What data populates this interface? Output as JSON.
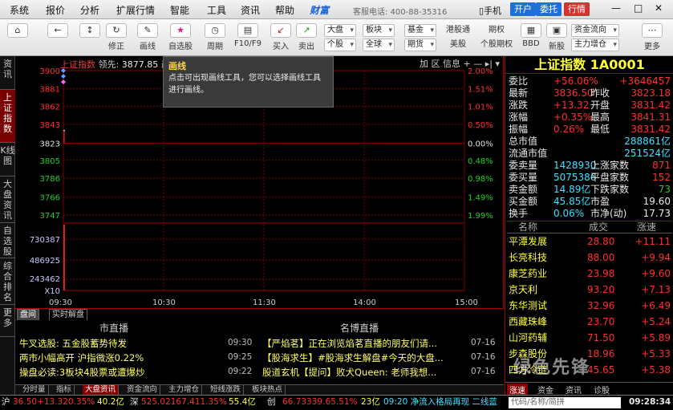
{
  "menubar": {
    "items": [
      "系统",
      "报价",
      "分析",
      "扩展行情",
      "智能",
      "工具",
      "资讯",
      "帮助"
    ],
    "brand": "财富",
    "hotline": "客服电话: 400-88-35316",
    "mobile": "手机",
    "btn_open": "开户",
    "btn_entrust": "委托",
    "btn_quote": "行情",
    "win_min": "—",
    "win_max": "□",
    "win_close": "✕"
  },
  "toolbar": {
    "home": "⌂",
    "back": "←",
    "updown": "↕",
    "refresh": "↻",
    "edit_label": "修正",
    "draw_label": "画线",
    "fav_label": "自选股",
    "period_label": "周期",
    "f10_label": "F10/F9",
    "buy_label": "买入",
    "sell_label": "卖出",
    "dd_market": "大盘",
    "dd_single": "个股",
    "dd_sector": "板块",
    "dd_global": "全球",
    "dd_fund": "基金",
    "dd_futures": "期货",
    "hk_label": "港股通",
    "us_label": "美股",
    "options_top": "期权",
    "options_label": "个股期权",
    "bbd_label": "BBD",
    "ipo_label": "新股",
    "dd_flow": "资金流向",
    "dd_main": "主力增仓",
    "more_label": "更多"
  },
  "lefttabs": [
    "资讯",
    "上证指数",
    "K线图",
    "大盘资讯",
    "自选股",
    "综合排名",
    "更多"
  ],
  "chart": {
    "index_name": "上证指数",
    "lead_label": "领先:",
    "lead_value": "3877.85",
    "lead_suffix": "最",
    "tools": [
      "加",
      "区",
      "信息",
      "+",
      "—",
      "▸|",
      "▾"
    ],
    "time_labels": [
      "09:30",
      "10:30",
      "11:30",
      "14:00",
      "15:00"
    ],
    "volume_labels": [
      "730387",
      "486925",
      "243462",
      "X10"
    ]
  },
  "chart_data": {
    "type": "line",
    "title": "上证指数",
    "y_ticks": [
      3900,
      3881,
      3862,
      3843,
      3823,
      3805,
      3786,
      3766,
      3747
    ],
    "y_pct_ticks": [
      "2.00%",
      "1.51%",
      "1.01%",
      "0.50%",
      "0.00%",
      "0.48%",
      "0.98%",
      "1.49%",
      "1.99%"
    ],
    "ylim": [
      3747,
      3900
    ],
    "x_ticks": [
      "09:30",
      "10:30",
      "11:30",
      "14:00",
      "15:00"
    ],
    "series": [
      {
        "values": [
          3836.5,
          3836.5
        ]
      }
    ],
    "markers": [
      3900,
      3894,
      3888
    ]
  },
  "tooltip": {
    "title": "画线",
    "text": "点击可出现画线工具，您可以选择画线工具进行画线。"
  },
  "newstabs": [
    "盘间",
    "实时解盘"
  ],
  "news": {
    "left_header": "市直播",
    "right_header": "名博直播",
    "rows": [
      {
        "left": "牛叉选股: 五金股蓄势待发",
        "ltime": "09:30",
        "right": "【严焰茗】正在浏览焰茗直播的朋友们请...",
        "rdate": "07-16"
      },
      {
        "left": "两市小幅高开 沪指微涨0.22%",
        "ltime": "09:25",
        "right": "【股海求生】#股海求生解盘#今天的大盘...",
        "rdate": "07-16"
      },
      {
        "left": "操盘必读:3板块4股票或遭爆炒",
        "ltime": "09:22",
        "right": "股道玄机【提问】败犬Queen: 老师我想...",
        "rdate": "07-16"
      }
    ]
  },
  "bottomtabs": [
    "分时量",
    "指标",
    "大盘资讯",
    "资金流向",
    "主力增仓",
    "短线涨跌",
    "板块热点"
  ],
  "statusbar": {
    "sh": "沪",
    "sh_val": "36.50+13.320.35%",
    "sh_amt": "40.2亿",
    "sz": "深",
    "sz_val": "525.02167.411.35%",
    "sz_amt": "55.4亿",
    "cy": "创",
    "cy_val": "66.73339.65.51%",
    "cy_amt": "23亿",
    "ticker": "09:20 净流入格局再现 二线蓝",
    "search": "代码/名称/简拼",
    "clock": "09:28:34"
  },
  "rightpanel": {
    "title": "上证指数 1A0001",
    "quotes": [
      {
        "l1": "委比",
        "v1": "+56.06%",
        "v2": "+3646457"
      },
      {
        "l1": "最新",
        "v1": "3836.50",
        "l2": "昨收",
        "v2": "3823.18"
      },
      {
        "l1": "涨跌",
        "v1": "+13.32",
        "l2": "开盘",
        "v2": "3831.42"
      },
      {
        "l1": "涨幅",
        "v1": "+0.35%",
        "l2": "最高",
        "v2": "3841.31"
      },
      {
        "l1": "振幅",
        "v1": "0.26%",
        "l2": "最低",
        "v2": "3831.42"
      },
      {
        "l1": "总市值",
        "v2": "288861亿"
      },
      {
        "l1": "流通市值",
        "v2": "251524亿"
      },
      {
        "l1": "委卖量",
        "v1": "1428930",
        "l2": "上涨家数",
        "v2": "871"
      },
      {
        "l1": "委买量",
        "v1": "5075386",
        "l2": "平盘家数",
        "v2": "152"
      },
      {
        "l1": "卖金额",
        "v1": "14.89亿",
        "l2": "下跌家数",
        "v2": "73"
      },
      {
        "l1": "买金额",
        "v1": "45.85亿",
        "l2": "市盈",
        "v2": "19.60"
      },
      {
        "l1": "换手",
        "v1": "0.06%",
        "l2": "市净(动)",
        "v2": "17.73"
      }
    ],
    "list_headers": [
      "名称",
      "成交",
      "涨速"
    ],
    "list": [
      {
        "name": "平潭发展",
        "price": "28.80",
        "chg": "+11.11"
      },
      {
        "name": "长亮科技",
        "price": "88.00",
        "chg": "+9.94"
      },
      {
        "name": "康芝药业",
        "price": "23.98",
        "chg": "+9.60"
      },
      {
        "name": "京天利",
        "price": "93.20",
        "chg": "+7.13"
      },
      {
        "name": "东华测试",
        "price": "32.96",
        "chg": "+6.49"
      },
      {
        "name": "西藏珠峰",
        "price": "23.70",
        "chg": "+5.24"
      },
      {
        "name": "山河药辅",
        "price": "71.50",
        "chg": "+5.89"
      },
      {
        "name": "步森股份",
        "price": "18.96",
        "chg": "+5.33"
      },
      {
        "name": "四方冷链",
        "price": "45.65",
        "chg": "+5.38"
      }
    ],
    "bottom_tabs": [
      "涨速",
      "资金",
      "资讯",
      "诊股"
    ]
  },
  "watermark": "绿色先锋",
  "colors": {
    "up": "#ff3030",
    "down": "#20d020",
    "accent": "#ffff40"
  }
}
